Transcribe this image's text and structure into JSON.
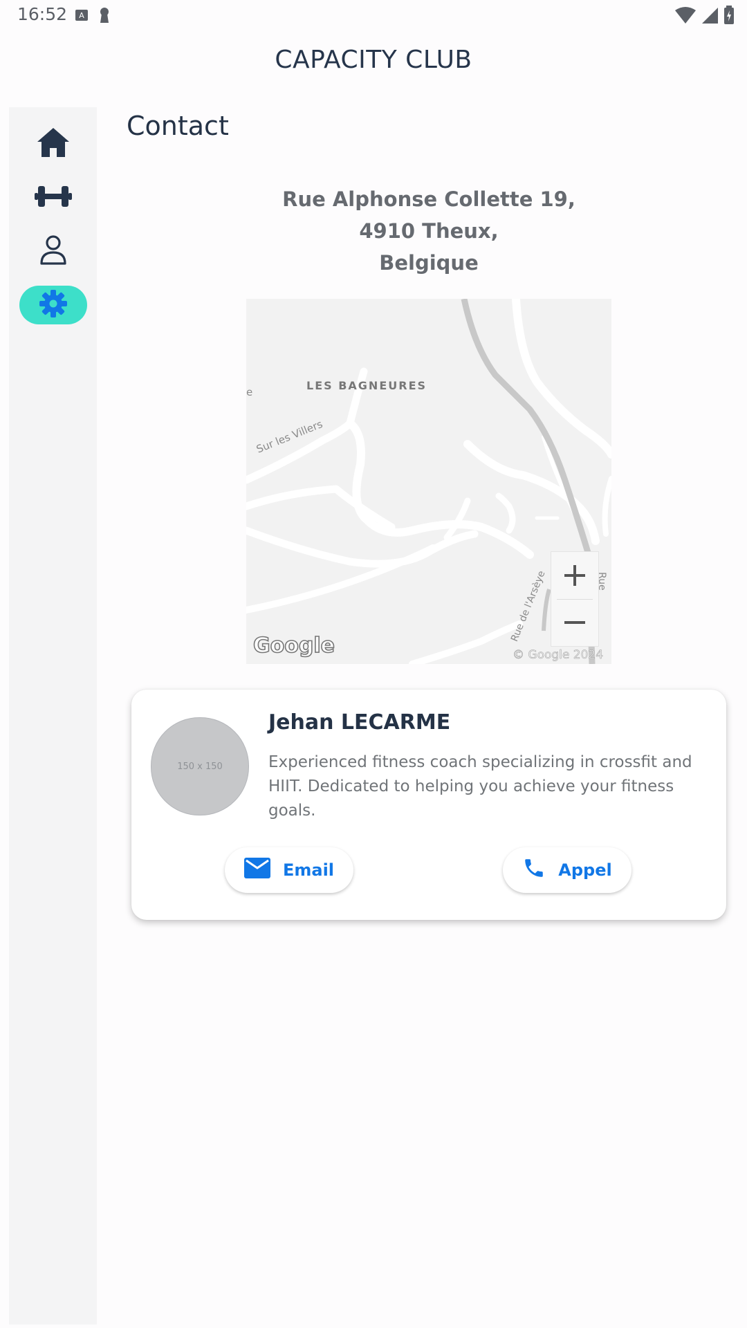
{
  "status_bar": {
    "time": "16:52"
  },
  "app": {
    "title": "CAPACITY CLUB"
  },
  "nav_rail": {
    "items": [
      {
        "icon": "home-icon",
        "active": false
      },
      {
        "icon": "dumbbell-icon",
        "active": false
      },
      {
        "icon": "person-icon",
        "active": false
      },
      {
        "icon": "settings-icon",
        "active": true
      }
    ],
    "active_color": "#3ddfc9",
    "active_icon_color": "#1177e6"
  },
  "page": {
    "title": "Contact"
  },
  "address": {
    "line1": "Rue Alphonse Collette 19,",
    "line2": "4910 Theux,",
    "line3": "Belgique"
  },
  "map": {
    "labels": {
      "area": "LES BAGNEURES",
      "road1": "Sur les Villers",
      "road2": "Rue de l'Arsèye",
      "road3": "Rue de la Gare",
      "edge": "e"
    },
    "logo": "Google",
    "copyright": "© Google 2024",
    "zoom_in": "+",
    "zoom_out": "−"
  },
  "coach": {
    "avatar_placeholder": "150 x 150",
    "name": "Jehan LECARME",
    "bio": "Experienced fitness coach specializing in crossfit and HIIT. Dedicated to helping you achieve your fitness goals.",
    "email_label": "Email",
    "call_label": "Appel",
    "accent": "#1177e6"
  }
}
